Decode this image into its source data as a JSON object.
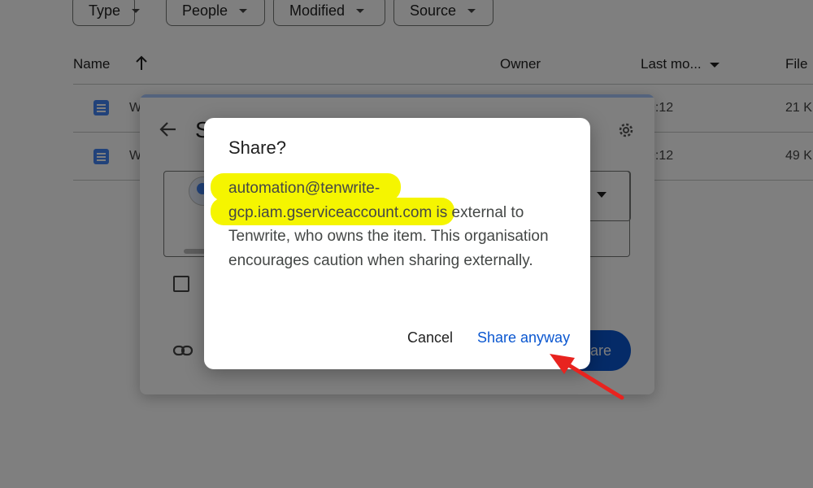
{
  "filters": [
    {
      "label": "Type"
    },
    {
      "label": "People"
    },
    {
      "label": "Modified"
    },
    {
      "label": "Source"
    }
  ],
  "columns": {
    "name": "Name",
    "owner": "Owner",
    "last_modified": "Last mo...",
    "file_size": "File"
  },
  "rows": [
    {
      "name_fragment": "W",
      "modified_fragment": "9:12",
      "size_fragment": "21 K"
    },
    {
      "name_fragment": "W",
      "modified_fragment": "9:12",
      "size_fragment": "49 K"
    }
  ],
  "share_dialog": {
    "title_fragment": "S",
    "right_fragment": ")",
    "share_button_fragment": "are"
  },
  "confirm_dialog": {
    "title": "Share?",
    "email_line1": "automation@tenwrite-",
    "email_line2": "gcp.iam.gserviceaccount.com",
    "body_rest": " is external to Tenwrite, who owns the item. This organisation encourages caution when sharing externally.",
    "cancel_label": "Cancel",
    "share_anyway_label": "Share anyway"
  },
  "colors": {
    "highlight": "#f5f500",
    "primary": "#0b57d0",
    "annotation_arrow": "#e8231f"
  },
  "icons": {
    "sort": "arrow-up-icon",
    "back": "arrow-left-icon",
    "settings": "gear-icon",
    "link": "link-icon",
    "doc": "google-doc-icon"
  }
}
